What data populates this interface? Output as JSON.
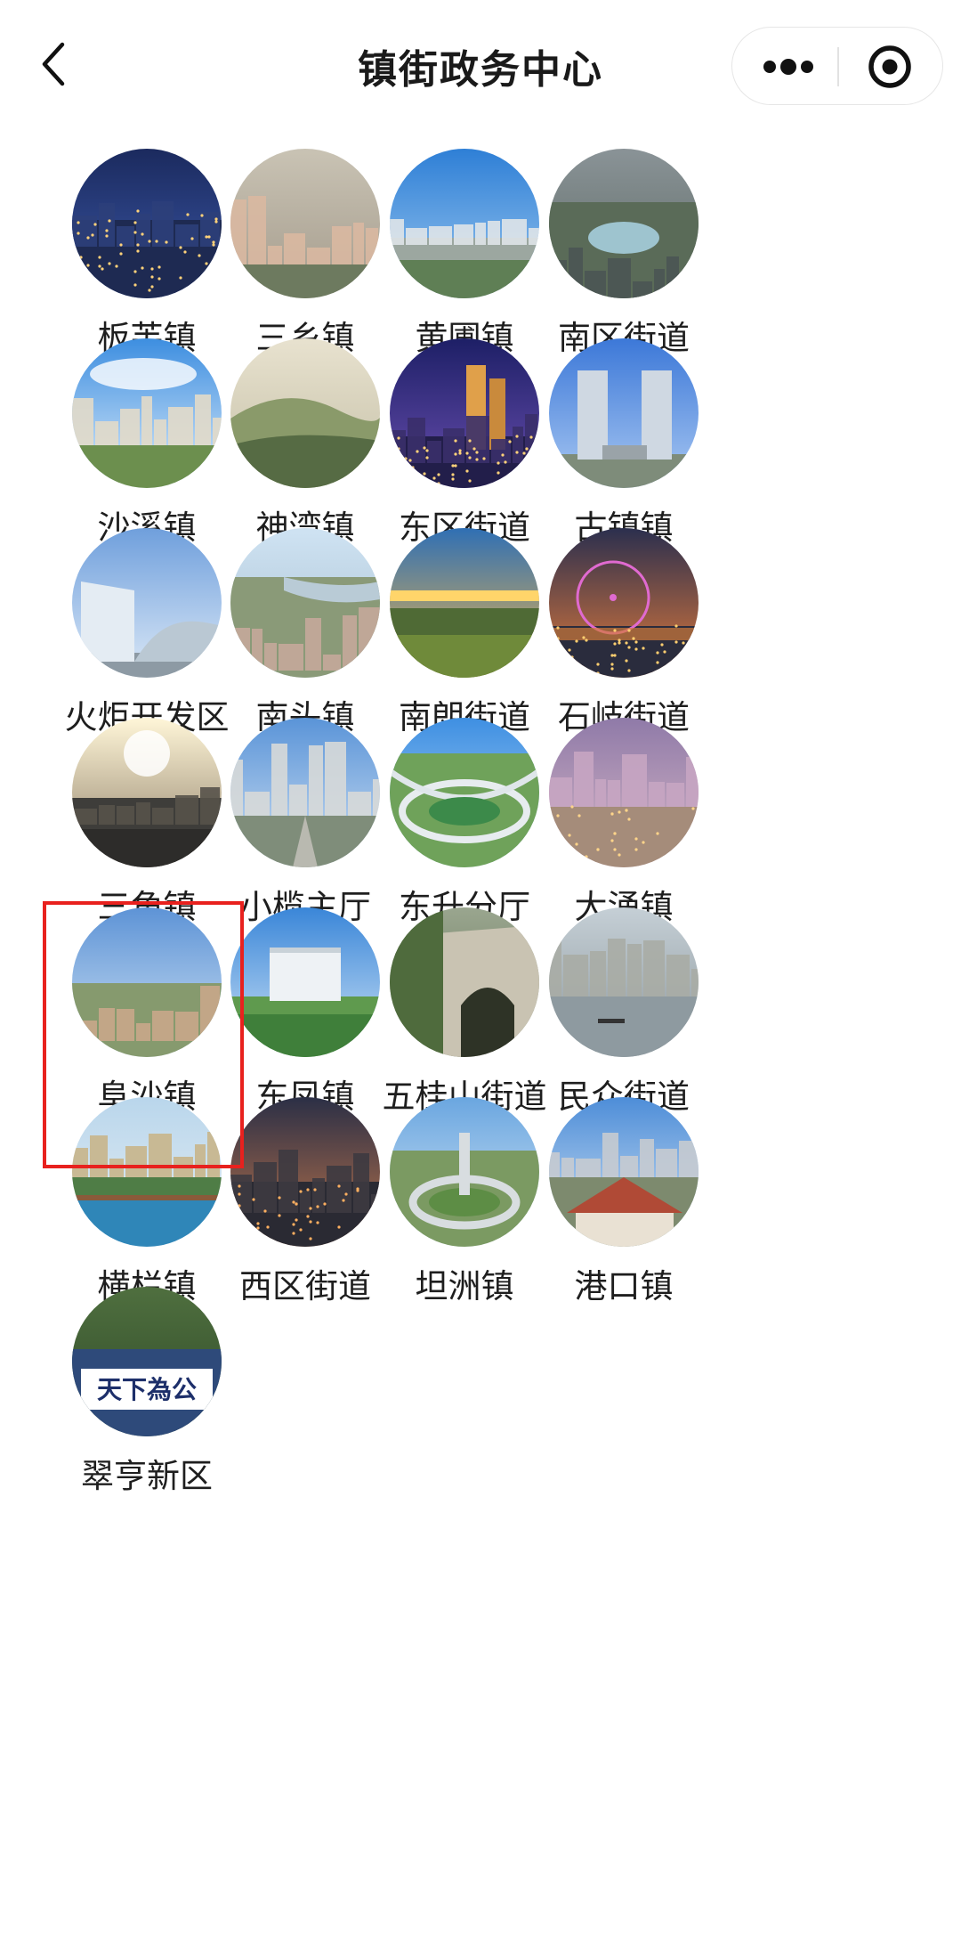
{
  "navbar": {
    "title": "镇街政务中心",
    "back_icon": "chevron-left-icon",
    "more_icon": "more-dots-icon",
    "close_icon": "target-circle-icon"
  },
  "highlight_color": "#e8211e",
  "towns": [
    {
      "name": "板芙镇",
      "scene": "city-night"
    },
    {
      "name": "三乡镇",
      "scene": "buildings-aerial"
    },
    {
      "name": "黄圃镇",
      "scene": "blue-sky-plain"
    },
    {
      "name": "南区街道",
      "scene": "park-aerial"
    },
    {
      "name": "沙溪镇",
      "scene": "town-clouds"
    },
    {
      "name": "神湾镇",
      "scene": "hills-misty"
    },
    {
      "name": "东区街道",
      "scene": "city-night-towers"
    },
    {
      "name": "古镇镇",
      "scene": "twin-towers"
    },
    {
      "name": "火炬开发区",
      "scene": "modern-buildings"
    },
    {
      "name": "南头镇",
      "scene": "river-aerial"
    },
    {
      "name": "南朗街道",
      "scene": "sunset-fields"
    },
    {
      "name": "石岐街道",
      "scene": "ferris-wheel-night"
    },
    {
      "name": "三角镇",
      "scene": "sunrise-factory"
    },
    {
      "name": "小榄主厅",
      "scene": "city-boulevard"
    },
    {
      "name": "东升分厅",
      "scene": "interchange"
    },
    {
      "name": "大涌镇",
      "scene": "purple-skyline"
    },
    {
      "name": "阜沙镇",
      "scene": "rural-town"
    },
    {
      "name": "东凤镇",
      "scene": "government-building"
    },
    {
      "name": "五桂山街道",
      "scene": "stone-arch"
    },
    {
      "name": "民众街道",
      "scene": "water-village"
    },
    {
      "name": "横栏镇",
      "scene": "riverside"
    },
    {
      "name": "西区街道",
      "scene": "evening-city"
    },
    {
      "name": "坦洲镇",
      "scene": "roundabout"
    },
    {
      "name": "港口镇",
      "scene": "red-roof-buildings"
    },
    {
      "name": "翠亨新区",
      "scene": "inscription-gate",
      "sign_text": "天下為公"
    }
  ]
}
